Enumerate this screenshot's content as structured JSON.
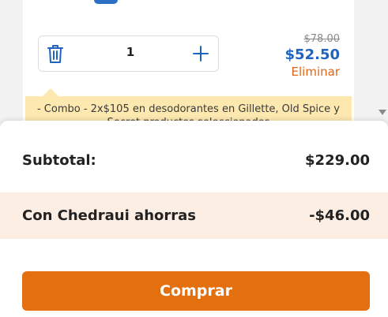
{
  "cart_item": {
    "quantity": "1",
    "old_price": "$78.00",
    "price": "$52.50",
    "remove_label": "Eliminar",
    "promo_text": "- Combo - 2x$105 en desodorantes en Gillette, Old Spice y Secret productos seleccionados"
  },
  "summary": {
    "subtotal_label": "Subtotal:",
    "subtotal_value": "$229.00",
    "savings_label": "Con Chedraui ahorras",
    "savings_value": "-$46.00",
    "buy_label": "Comprar"
  },
  "colors": {
    "accent_orange": "#e36f0e",
    "price_blue": "#1f63c0",
    "promo_bg": "#fde8b0",
    "savings_bg": "#fdeee3"
  },
  "icons": {
    "trash": "trash-icon",
    "plus": "plus-icon"
  }
}
